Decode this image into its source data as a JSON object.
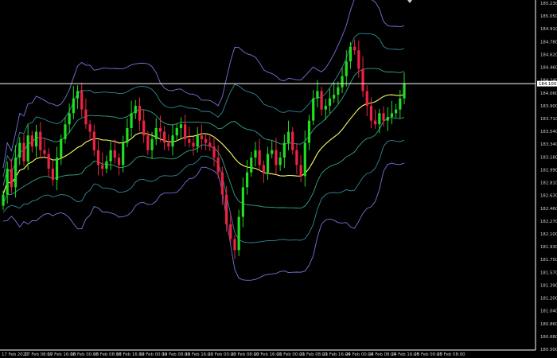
{
  "chart_data": {
    "type": "candlestick",
    "symbol": "",
    "timeframe": "H4",
    "price_axis": {
      "labels": [
        "185.230",
        "185.050",
        "184.910",
        "184.780",
        "184.620",
        "184.460",
        "184.240",
        "184.060",
        "183.900",
        "183.710",
        "183.540",
        "183.340",
        "183.180",
        "182.990",
        "182.810",
        "182.630",
        "182.460",
        "182.270",
        "182.100",
        "181.930",
        "181.750",
        "181.570",
        "181.390",
        "181.200",
        "181.040",
        "180.860",
        "180.680",
        "180.500"
      ],
      "ylim": [
        180.5,
        185.23
      ]
    },
    "time_axis": {
      "labels": [
        "17 Feb 2020",
        "17 Feb 08:00",
        "17 Feb 16:00",
        "18 Feb 00:00",
        "18 Feb 08:00",
        "18 Feb 16:00",
        "19 Feb 00:00",
        "19 Feb 08:00",
        "19 Feb 16:00",
        "20 Feb 00:00",
        "20 Feb 08:00",
        "20 Feb 16:00",
        "21 Feb 00:00",
        "21 Feb 08:00",
        "21 Feb 16:00",
        "24 Feb 00:00",
        "24 Feb 08:00",
        "24 Feb 16:00",
        "25 Feb 00:00",
        "25 Feb 08:00"
      ]
    },
    "bid_line": {
      "price": 184.1,
      "label": "184.100",
      "color": "#ffffff"
    },
    "colors": {
      "bull_candle": "#22dd22",
      "bear_candle": "#ee2244",
      "middle_band": "#ffff66",
      "inner_band": "#40c0a0",
      "mid_band": "#3aa0b0",
      "outer_band": "#8888ff",
      "background": "#000000",
      "axis": "#ffffff"
    },
    "closes": [
      182.6,
      182.95,
      182.7,
      183.1,
      183.3,
      183.05,
      183.4,
      183.25,
      183.45,
      183.2,
      183.15,
      182.95,
      182.8,
      183.1,
      183.35,
      183.55,
      183.7,
      183.9,
      184.0,
      183.75,
      183.55,
      183.45,
      183.2,
      183.0,
      182.95,
      183.05,
      183.2,
      183.1,
      183.0,
      183.3,
      183.5,
      183.7,
      183.8,
      183.6,
      183.4,
      183.2,
      183.35,
      183.5,
      183.45,
      183.3,
      183.25,
      183.4,
      183.5,
      183.55,
      183.35,
      183.3,
      183.25,
      183.4,
      183.35,
      183.3,
      183.25,
      183.1,
      182.9,
      182.6,
      182.2,
      182.0,
      181.85,
      182.3,
      182.7,
      182.9,
      183.1,
      183.2,
      183.0,
      182.9,
      183.15,
      183.2,
      183.0,
      183.1,
      183.3,
      183.45,
      183.2,
      183.0,
      182.85,
      183.3,
      183.6,
      183.9,
      184.0,
      183.75,
      183.8,
      183.9,
      183.95,
      184.05,
      184.2,
      184.4,
      184.6,
      184.55,
      184.3,
      184.0,
      183.8,
      183.6,
      183.55,
      183.7,
      183.6,
      183.65,
      183.7,
      183.75,
      183.9,
      184.1
    ]
  }
}
